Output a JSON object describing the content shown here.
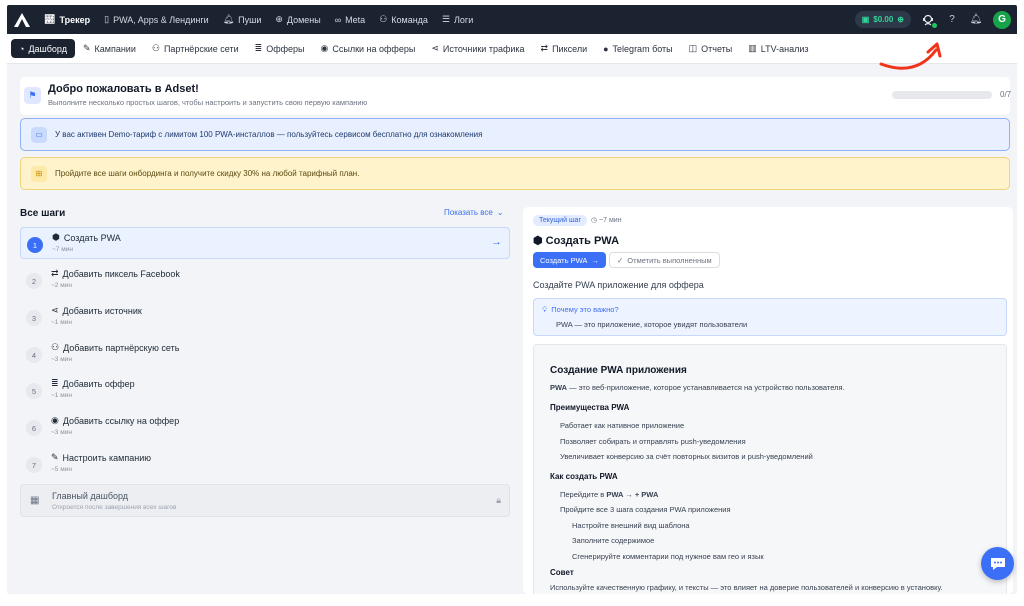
{
  "topnav": {
    "items": [
      {
        "label": "Трекер",
        "icon": "chart-icon",
        "active": true
      },
      {
        "label": "PWA, Apps & Лендинги",
        "icon": "phone-icon"
      },
      {
        "label": "Пуши",
        "icon": "bell-icon"
      },
      {
        "label": "Домены",
        "icon": "globe-icon"
      },
      {
        "label": "Meta",
        "icon": "infinity-icon"
      },
      {
        "label": "Команда",
        "icon": "team-icon"
      },
      {
        "label": "Логи",
        "icon": "list-icon"
      }
    ],
    "balance": "$0.00",
    "avatar_letter": "G"
  },
  "subnav": {
    "items": [
      {
        "label": "Дашборд",
        "icon": "gauge-icon",
        "active": true
      },
      {
        "label": "Кампании",
        "icon": "edit-icon"
      },
      {
        "label": "Партнёрские сети",
        "icon": "handshake-icon"
      },
      {
        "label": "Офферы",
        "icon": "stack-icon"
      },
      {
        "label": "Ссылки на офферы",
        "icon": "pin-icon"
      },
      {
        "label": "Источники трафика",
        "icon": "share-icon"
      },
      {
        "label": "Пиксели",
        "icon": "swap-icon"
      },
      {
        "label": "Telegram боты",
        "icon": "telegram-icon"
      },
      {
        "label": "Отчеты",
        "icon": "report-icon"
      },
      {
        "label": "LTV-анализ",
        "icon": "bars-icon"
      }
    ]
  },
  "welcome": {
    "title": "Добро пожаловать в Adset!",
    "subtitle": "Выполните несколько простых шагов, чтобы настроить и запустить свою первую кампанию",
    "progress": "0/7",
    "progress_fraction": 0
  },
  "banners": {
    "demo": "У вас активен Demo-тариф с лимитом 100 PWA-инсталлов — пользуйтесь сервисом бесплатно для ознакомления",
    "promo": "Пройдите все шаги онбординга и получите скидку 30% на любой тарифный план."
  },
  "steps": {
    "title": "Все шаги",
    "show_all": "Показать все",
    "items": [
      {
        "num": "1",
        "icon": "android-icon",
        "name": "Создать PWA",
        "time": "~7 мин",
        "current": true
      },
      {
        "num": "2",
        "icon": "swap-icon",
        "name": "Добавить пиксель Facebook",
        "time": "~2 мин"
      },
      {
        "num": "3",
        "icon": "share-icon",
        "name": "Добавить источник",
        "time": "~1 мин"
      },
      {
        "num": "4",
        "icon": "handshake-icon",
        "name": "Добавить партнёрскую сеть",
        "time": "~3 мин"
      },
      {
        "num": "5",
        "icon": "stack-icon",
        "name": "Добавить оффер",
        "time": "~1 мин"
      },
      {
        "num": "6",
        "icon": "pin-icon",
        "name": "Добавить ссылку на оффер",
        "time": "~3 мин"
      },
      {
        "num": "7",
        "icon": "edit-icon",
        "name": "Настроить кампанию",
        "time": "~5 мин"
      }
    ],
    "dashboard": {
      "name": "Главный дашборд",
      "sub": "Откроется после завершения всех шагов"
    }
  },
  "panel": {
    "badge": "Текущий шаг",
    "time": "~7 мин",
    "title": "Создать PWA",
    "primary_btn": "Создать PWA",
    "outline_btn": "Отметить выполненным",
    "desc": "Создайте PWA приложение для оффера",
    "why_q": "Почему это важно?",
    "why_a": "PWA — это приложение, которое увидят пользователи",
    "content": {
      "h1": "Создание PWA приложения",
      "intro_bold": "PWA",
      "intro": " — это веб-приложение, которое устанавливается на устройство пользователя.",
      "adv_title": "Преимущества PWA",
      "advantages": [
        "Работает как нативное приложение",
        "Позволяет собирать и отправлять push-уведомления",
        "Увеличивает конверсию за счёт повторных визитов и push-уведомлений"
      ],
      "how_title": "Как создать PWA",
      "how_1_pre": "Перейдите в ",
      "how_1_bold": "PWA → + PWA",
      "how_2": "Пройдите все 3 шага создания PWA приложения",
      "substeps": [
        "Настройте внешний вид шаблона",
        "Заполните содержимое",
        "Сгенерируйте комментарии под нужное вам гео и язык"
      ],
      "tip_title": "Совет",
      "tip": "Используйте качественную графику, и тексты — это влияет на доверие пользователей и конверсию в установку."
    }
  },
  "colors": {
    "accent": "#3b6ff5",
    "nav_bg": "#1b2331",
    "annotation": "#f0341c"
  }
}
